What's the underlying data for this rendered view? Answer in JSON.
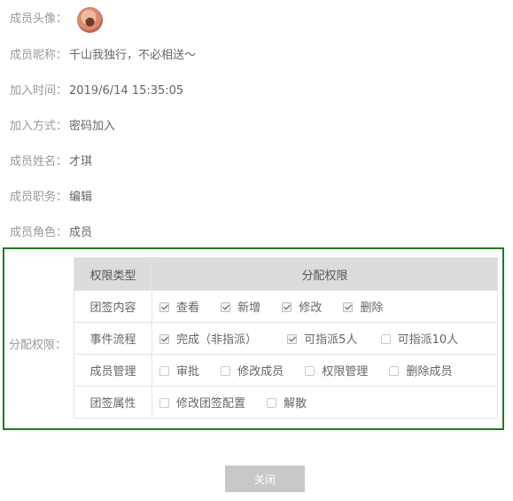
{
  "member": {
    "avatar_label": "成员头像：",
    "nickname_label": "成员昵称：",
    "nickname": "千山我独行，不必相送～",
    "join_time_label": "加入时间：",
    "join_time": "2019/6/14 15:35:05",
    "join_method_label": "加入方式：",
    "join_method": "密码加入",
    "name_label": "成员姓名：",
    "name": "才琪",
    "position_label": "成员职务：",
    "position": "编辑",
    "role_label": "成员角色：",
    "role": "成员"
  },
  "permissions": {
    "label": "分配权限：",
    "header_type": "权限类型",
    "header_assign": "分配权限",
    "rows": [
      {
        "type": "团签内容",
        "options": [
          {
            "label": "查看",
            "checked": true
          },
          {
            "label": "新增",
            "checked": true
          },
          {
            "label": "修改",
            "checked": true
          },
          {
            "label": "删除",
            "checked": true
          }
        ]
      },
      {
        "type": "事件流程",
        "options": [
          {
            "label": "完成（非指派）",
            "checked": true
          },
          {
            "label": "可指派5人",
            "checked": true
          },
          {
            "label": "可指派10人",
            "checked": false
          }
        ]
      },
      {
        "type": "成员管理",
        "options": [
          {
            "label": "审批",
            "checked": false
          },
          {
            "label": "修改成员",
            "checked": false
          },
          {
            "label": "权限管理",
            "checked": false
          },
          {
            "label": "删除成员",
            "checked": false
          }
        ]
      },
      {
        "type": "团签属性",
        "options": [
          {
            "label": "修改团签配置",
            "checked": false
          },
          {
            "label": "解散",
            "checked": false
          }
        ]
      }
    ]
  },
  "actions": {
    "close_label": "关闭"
  },
  "colors": {
    "highlight_border": "#1f7a1f",
    "header_bg": "#dcdcdc",
    "button_bg": "#c8c8c8"
  }
}
